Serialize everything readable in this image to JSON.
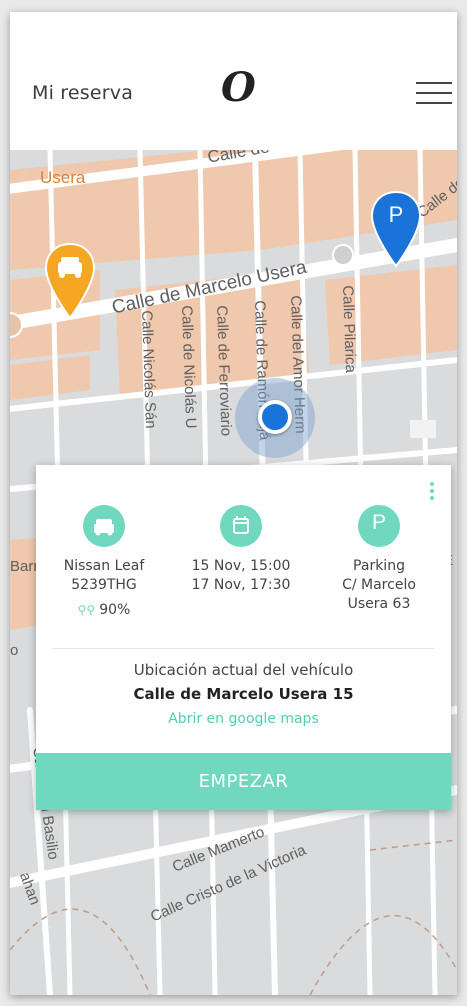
{
  "header": {
    "title": "Mi reserva",
    "logo": "O",
    "menu_icon": "hamburger-menu-icon"
  },
  "map": {
    "labels": {
      "usera": "Usera",
      "calle_top": "Calle de",
      "calle_de_right": "Calle de",
      "marcelo_usera": "Calle de Marcelo Usera",
      "nicolas_san": "Calle Nicolás Sán",
      "de_nicolas": "Calle de Nicolás U",
      "ferrovia": "Calle de Ferroviario",
      "ramon": "Calle de Ramón Lujá",
      "amor_herm": "Calle del Amor Herm",
      "pilarica": "Calle Pilarica",
      "barr": "Barr",
      "san_basilio": "Calle San Basilio",
      "ahan": "ahan",
      "mamerto": "Calle Mamerto",
      "cristo": "Calle Cristo de la Victoria",
      "e_right": "E",
      "ca_right": "Ca",
      "o_left": "o"
    },
    "pins": {
      "car_pin_color": "#f5a623",
      "parking_pin_color": "#1a73d9",
      "parking_letter": "P"
    }
  },
  "card": {
    "vehicle": {
      "icon": "car-icon",
      "model": "Nissan Leaf",
      "plate": "5239THG",
      "battery": "90%",
      "battery_icon": "battery-icon"
    },
    "dates": {
      "icon": "calendar-icon",
      "start": "15 Nov, 15:00",
      "end": "17 Nov, 17:30"
    },
    "parking": {
      "icon_letter": "P",
      "line1": "Parking",
      "line2": "C/ Marcelo",
      "line3": "Usera 63"
    },
    "location_caption": "Ubicación actual del vehículo",
    "location_address": "Calle de Marcelo Usera 15",
    "maps_link": "Abrir en google maps",
    "start_button": "EMPEZAR"
  },
  "colors": {
    "accent": "#6fd8bf",
    "map_bg": "#dadbdc",
    "building": "#efc8ad"
  }
}
